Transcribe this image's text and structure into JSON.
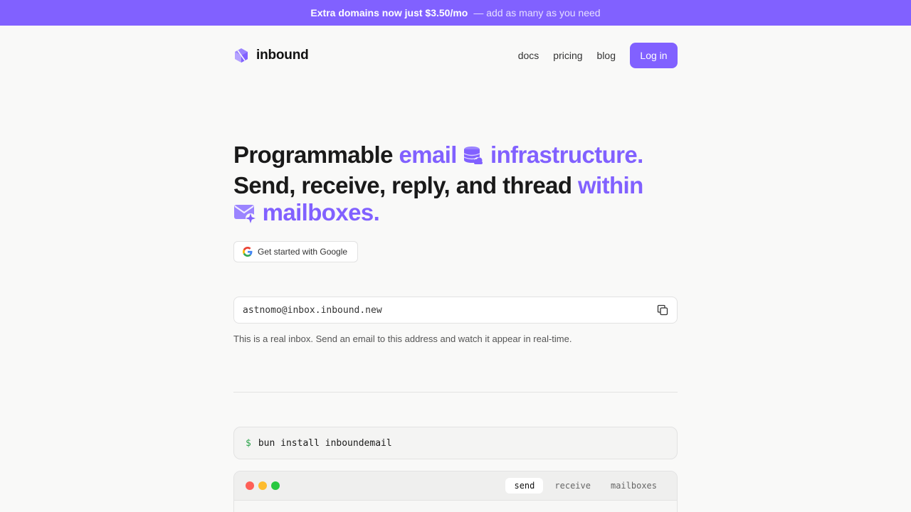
{
  "banner": {
    "strong": "Extra domains now just $3.50/mo",
    "soft": "— add as many as you need"
  },
  "nav": {
    "brand": "inbound",
    "links": [
      "docs",
      "pricing",
      "blog"
    ],
    "login": "Log in"
  },
  "hero": {
    "part1": "Programmable",
    "accent1": "email",
    "accent2": "infrastructure.",
    "part2": "Send, receive, reply, and thread",
    "accent3": "within",
    "accent4": "mailboxes."
  },
  "google_button": "Get started with Google",
  "inbox": {
    "address": "astnomo@inbox.inbound.new",
    "helper": "This is a real inbox. Send an email to this address and watch it appear in real-time."
  },
  "install": {
    "prompt": "$",
    "command": "bun install inboundemail"
  },
  "code_window": {
    "tabs": [
      "send",
      "receive",
      "mailboxes"
    ],
    "active_tab": "send"
  },
  "colors": {
    "accent": "#8161ff",
    "dot_red": "#fe5f57",
    "dot_yellow": "#febc2e",
    "dot_green": "#28c840"
  },
  "icons": [
    "inbound-logo-icon",
    "database-cloud-icon",
    "mail-sparkle-icon",
    "google-icon",
    "copy-icon"
  ]
}
